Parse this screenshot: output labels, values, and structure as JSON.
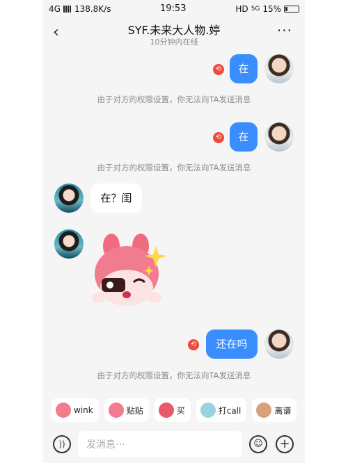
{
  "status_bar": {
    "network": "4G",
    "speed": "138.8K/s",
    "time": "19:53",
    "hd": "HD",
    "signal_5g": "5G",
    "battery": "15%"
  },
  "header": {
    "title": "SYF.未来大人物.婷",
    "subtitle": "10分钟内在线",
    "back_icon": "‹",
    "more_icon": "···"
  },
  "messages": [
    {
      "from": "me",
      "text": "在"
    },
    {
      "from": "system",
      "text": "由于对方的权限设置，你无法向TA发送消息"
    },
    {
      "from": "me",
      "text": "在"
    },
    {
      "from": "system",
      "text": "由于对方的权限设置，你无法向TA发送消息"
    },
    {
      "from": "her",
      "text": "在？闺"
    },
    {
      "from": "her",
      "type": "sticker"
    },
    {
      "from": "me",
      "text": "还在吗"
    },
    {
      "from": "system",
      "text": "由于对方的权限设置，你无法向TA发送消息"
    }
  ],
  "quick_replies": [
    {
      "label": "wink",
      "color": "#f47a8e"
    },
    {
      "label": "贴贴",
      "color": "#f47a8e"
    },
    {
      "label": "买",
      "color": "#e85a6a"
    },
    {
      "label": "打call",
      "color": "#9ad3e0"
    },
    {
      "label": "离谱",
      "color": "#d9a07a"
    }
  ],
  "input": {
    "placeholder": "发消息···"
  },
  "colors": {
    "accent": "#3a8dfc",
    "fail": "#f04a3e"
  }
}
